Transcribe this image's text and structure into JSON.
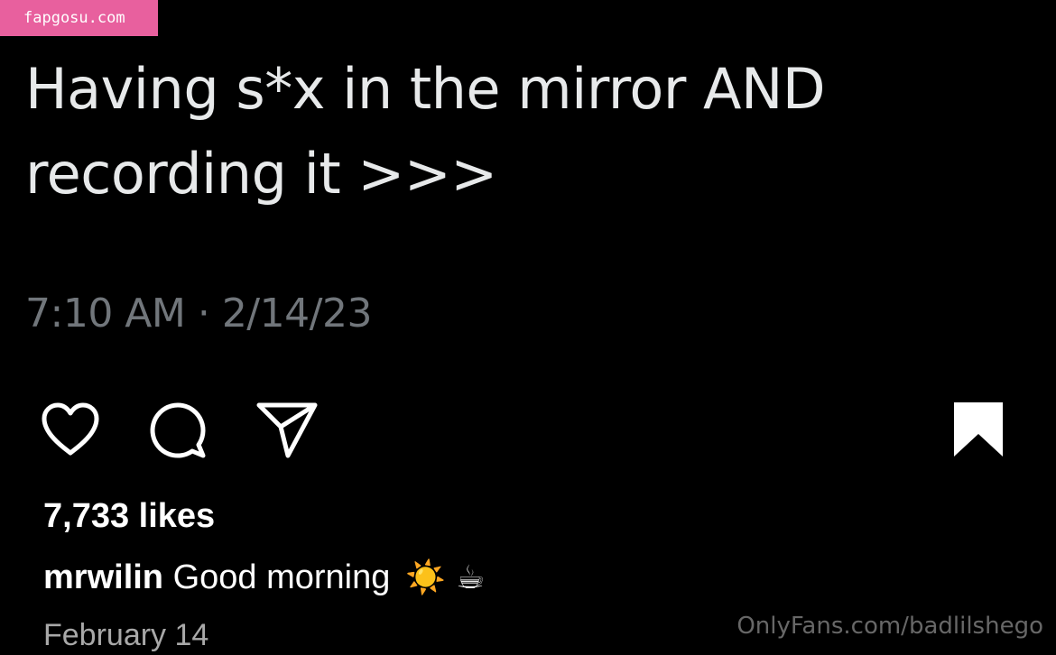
{
  "badge": {
    "text": "fapgosu.com",
    "color": "#e8609e"
  },
  "tweet": {
    "text_line1": "Having s*x in the mirror AND",
    "text_line2": "recording it >>>",
    "timestamp": "7:10 AM · 2/14/23"
  },
  "actions": {
    "like_icon": "heart-icon",
    "comment_icon": "comment-icon",
    "share_icon": "paper-plane-icon",
    "save_icon": "bookmark-icon"
  },
  "post": {
    "likes": "7,733 likes",
    "username": "mrwilin",
    "caption_text": "Good morning",
    "caption_emojis": "☀️ ☕",
    "date": "February 14"
  },
  "watermark": {
    "text": "OnlyFans.com/badlilshego"
  }
}
